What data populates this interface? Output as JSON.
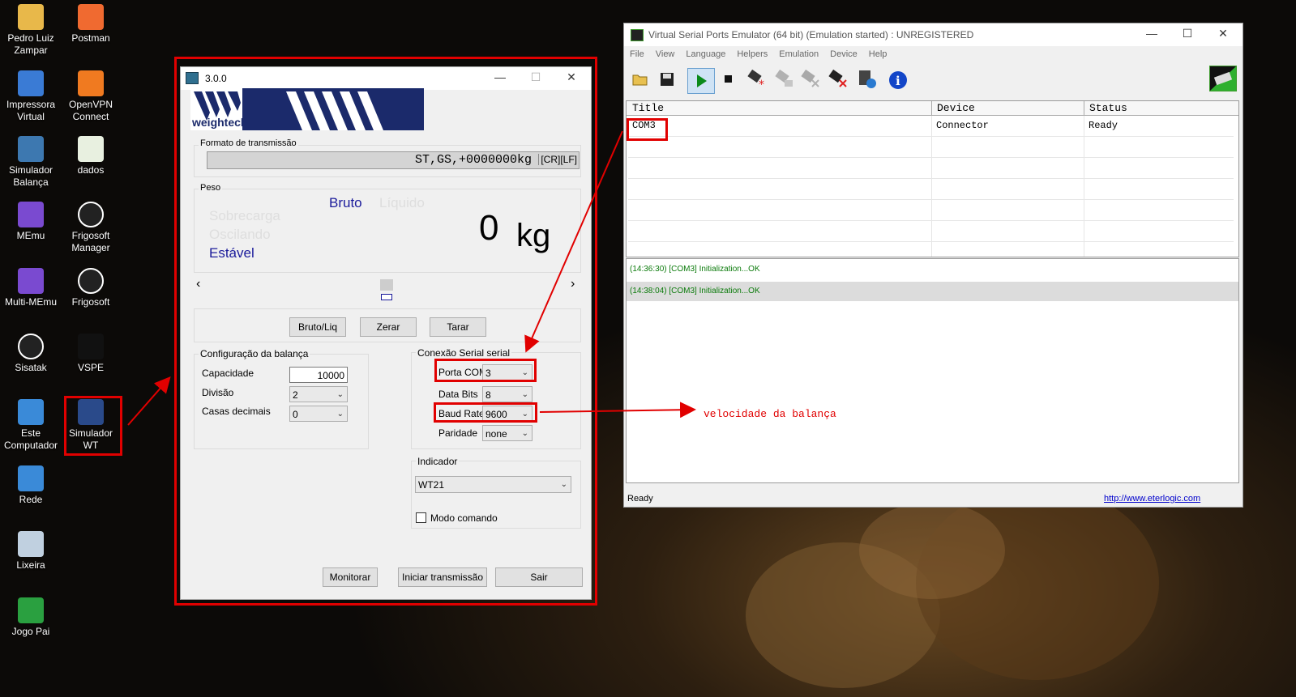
{
  "desktop": {
    "icons": [
      {
        "label": "Pedro Luiz\nZampar",
        "icon": "user-folder-icon"
      },
      {
        "label": "Postman",
        "icon": "postman-icon"
      },
      {
        "label": "Impressora\nVirtual",
        "icon": "printer-icon"
      },
      {
        "label": "OpenVPN\nConnect",
        "icon": "openvpn-icon"
      },
      {
        "label": "Simulador\nBalança",
        "icon": "python-icon"
      },
      {
        "label": "dados",
        "icon": "spreadsheet-icon"
      },
      {
        "label": "MEmu",
        "icon": "memu-icon"
      },
      {
        "label": "Frigosoft\nManager",
        "icon": "frigosoft-icon"
      },
      {
        "label": "Multi-MEmu",
        "icon": "memu-icon"
      },
      {
        "label": "Frigosoft",
        "icon": "frigosoft-icon"
      },
      {
        "label": "Sisatak",
        "icon": "sisatak-icon"
      },
      {
        "label": "VSPE",
        "icon": "vspe-icon"
      },
      {
        "label": "Este\nComputador",
        "icon": "computer-icon"
      },
      {
        "label": "Simulador\nWT",
        "icon": "simulator-icon"
      },
      {
        "label": "Rede",
        "icon": "network-icon"
      },
      {
        "label": "Lixeira",
        "icon": "recycle-bin-icon"
      },
      {
        "label": "Jogo Pai",
        "icon": "game-icon"
      }
    ]
  },
  "simulator": {
    "title": "3.0.0",
    "logo_text": "weightech",
    "transmission": {
      "label": "Formato de transmissão",
      "value": "ST,GS,+0000000kg",
      "suffix": "[CR][LF]"
    },
    "weight": {
      "label": "Peso",
      "bruto": "Bruto",
      "liquido": "Líquido",
      "sobrecarga": "Sobrecarga",
      "oscilando": "Oscilando",
      "estavel": "Estável",
      "value": "0",
      "unit": "kg"
    },
    "slider": {
      "left": "‹",
      "right": "›"
    },
    "buttons": {
      "bruto_liq": "Bruto/Liq",
      "zerar": "Zerar",
      "tarar": "Tarar"
    },
    "config": {
      "label": "Configuração da balança",
      "capacidade_label": "Capacidade",
      "capacidade_value": "10000",
      "divisao_label": "Divisão",
      "divisao_value": "2",
      "casas_label": "Casas decimais",
      "casas_value": "0"
    },
    "serial": {
      "label": "Conexão Serial serial",
      "porta_label": "Porta COM",
      "porta_value": "3",
      "databits_label": "Data Bits",
      "databits_value": "8",
      "baud_label": "Baud Rate",
      "baud_value": "9600",
      "paridade_label": "Paridade",
      "paridade_value": "none"
    },
    "indicador": {
      "label": "Indicador",
      "value": "WT21",
      "modo_comando": "Modo comando",
      "modo_comando_checked": false
    },
    "footer": {
      "monitorar": "Monitorar",
      "iniciar": "Iniciar transmissão",
      "sair": "Sair"
    }
  },
  "vspe": {
    "title": "Virtual Serial Ports Emulator (64 bit) (Emulation started) : UNREGISTERED",
    "menu": [
      "File",
      "View",
      "Language",
      "Helpers",
      "Emulation",
      "Device",
      "Help"
    ],
    "columns": [
      "Title",
      "Device",
      "Status"
    ],
    "rows": [
      {
        "title": "COM3",
        "device": "Connector",
        "status": "Ready"
      }
    ],
    "log": [
      "(14:36:30) [COM3] Initialization...OK",
      "(14:38:04) [COM3] Initialization...OK"
    ],
    "status": "Ready",
    "link": "http://www.eterlogic.com"
  },
  "annotation": {
    "text": "velocidade da balança",
    "color": "#e10000"
  }
}
